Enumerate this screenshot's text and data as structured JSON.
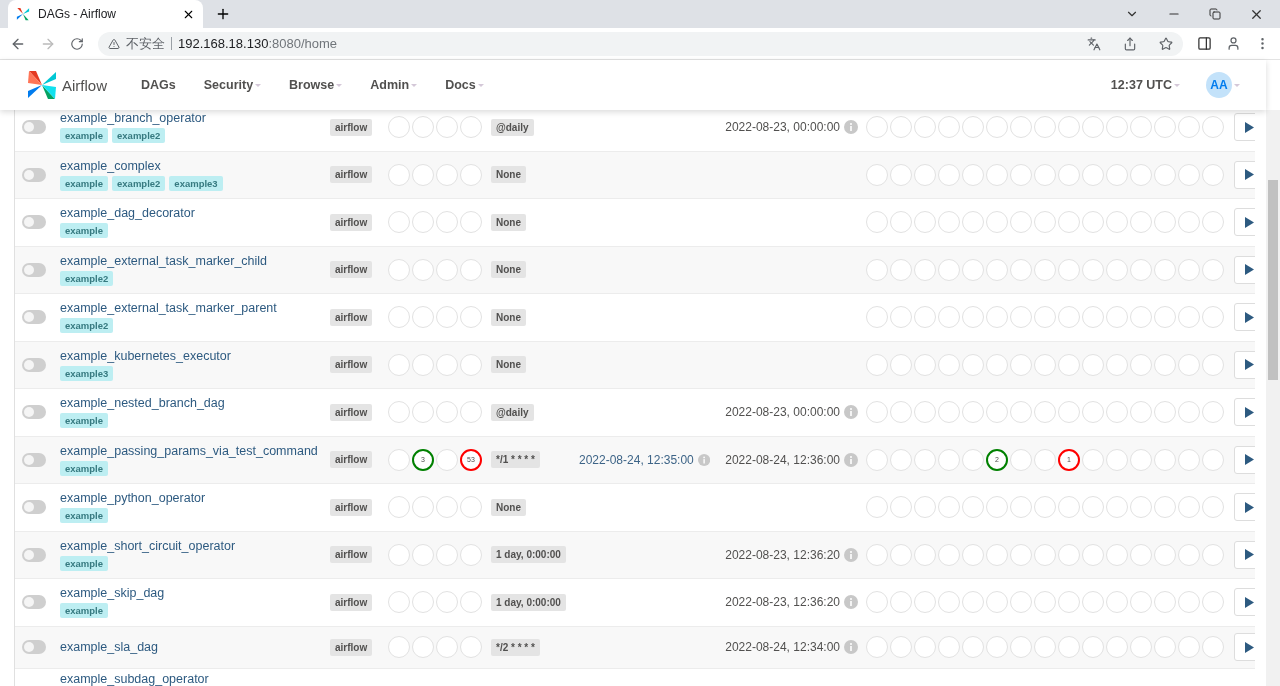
{
  "browser": {
    "tab_title": "DAGs - Airflow",
    "security_label": "不安全",
    "url_host": "192.168.18.130",
    "url_rest": ":8080/home"
  },
  "navbar": {
    "brand": "Airflow",
    "menu": [
      {
        "label": "DAGs",
        "dropdown": false
      },
      {
        "label": "Security",
        "dropdown": true
      },
      {
        "label": "Browse",
        "dropdown": true
      },
      {
        "label": "Admin",
        "dropdown": true
      },
      {
        "label": "Docs",
        "dropdown": true
      }
    ],
    "time": "12:37 UTC",
    "avatar": "AA"
  },
  "dags": [
    {
      "name": "example_branch_operator",
      "on": false,
      "tags": [
        "example",
        "example2"
      ],
      "owner": "airflow",
      "runs": [
        {
          "color": "#e2e2e2"
        },
        {
          "color": "#e2e2e2"
        },
        {
          "color": "#e2e2e2"
        },
        {
          "color": "#e2e2e2"
        }
      ],
      "schedule": "@daily",
      "next_run": "2022-08-23, 00:00:00",
      "tasks": [
        {
          "color": "#e2e2e2"
        },
        {
          "color": "#e2e2e2"
        },
        {
          "color": "#e2e2e2"
        },
        {
          "color": "#e2e2e2"
        },
        {
          "color": "#e2e2e2"
        },
        {
          "color": "#e2e2e2"
        },
        {
          "color": "#e2e2e2"
        },
        {
          "color": "#e2e2e2"
        },
        {
          "color": "#e2e2e2"
        },
        {
          "color": "#e2e2e2"
        },
        {
          "color": "#e2e2e2"
        },
        {
          "color": "#e2e2e2"
        },
        {
          "color": "#e2e2e2"
        },
        {
          "color": "#e2e2e2"
        },
        {
          "color": "#e2e2e2"
        }
      ]
    },
    {
      "name": "example_complex",
      "on": false,
      "tags": [
        "example",
        "example2",
        "example3"
      ],
      "owner": "airflow",
      "runs": [
        {
          "color": "#e2e2e2"
        },
        {
          "color": "#e2e2e2"
        },
        {
          "color": "#e2e2e2"
        },
        {
          "color": "#e2e2e2"
        }
      ],
      "schedule": "None",
      "tasks": [
        {
          "color": "#e2e2e2"
        },
        {
          "color": "#e2e2e2"
        },
        {
          "color": "#e2e2e2"
        },
        {
          "color": "#e2e2e2"
        },
        {
          "color": "#e2e2e2"
        },
        {
          "color": "#e2e2e2"
        },
        {
          "color": "#e2e2e2"
        },
        {
          "color": "#e2e2e2"
        },
        {
          "color": "#e2e2e2"
        },
        {
          "color": "#e2e2e2"
        },
        {
          "color": "#e2e2e2"
        },
        {
          "color": "#e2e2e2"
        },
        {
          "color": "#e2e2e2"
        },
        {
          "color": "#e2e2e2"
        },
        {
          "color": "#e2e2e2"
        }
      ]
    },
    {
      "name": "example_dag_decorator",
      "on": false,
      "tags": [
        "example"
      ],
      "owner": "airflow",
      "runs": [
        {
          "color": "#e2e2e2"
        },
        {
          "color": "#e2e2e2"
        },
        {
          "color": "#e2e2e2"
        },
        {
          "color": "#e2e2e2"
        }
      ],
      "schedule": "None",
      "tasks": [
        {
          "color": "#e2e2e2"
        },
        {
          "color": "#e2e2e2"
        },
        {
          "color": "#e2e2e2"
        },
        {
          "color": "#e2e2e2"
        },
        {
          "color": "#e2e2e2"
        },
        {
          "color": "#e2e2e2"
        },
        {
          "color": "#e2e2e2"
        },
        {
          "color": "#e2e2e2"
        },
        {
          "color": "#e2e2e2"
        },
        {
          "color": "#e2e2e2"
        },
        {
          "color": "#e2e2e2"
        },
        {
          "color": "#e2e2e2"
        },
        {
          "color": "#e2e2e2"
        },
        {
          "color": "#e2e2e2"
        },
        {
          "color": "#e2e2e2"
        }
      ]
    },
    {
      "name": "example_external_task_marker_child",
      "on": false,
      "tags": [
        "example2"
      ],
      "owner": "airflow",
      "runs": [
        {
          "color": "#e2e2e2"
        },
        {
          "color": "#e2e2e2"
        },
        {
          "color": "#e2e2e2"
        },
        {
          "color": "#e2e2e2"
        }
      ],
      "schedule": "None",
      "tasks": [
        {
          "color": "#e2e2e2"
        },
        {
          "color": "#e2e2e2"
        },
        {
          "color": "#e2e2e2"
        },
        {
          "color": "#e2e2e2"
        },
        {
          "color": "#e2e2e2"
        },
        {
          "color": "#e2e2e2"
        },
        {
          "color": "#e2e2e2"
        },
        {
          "color": "#e2e2e2"
        },
        {
          "color": "#e2e2e2"
        },
        {
          "color": "#e2e2e2"
        },
        {
          "color": "#e2e2e2"
        },
        {
          "color": "#e2e2e2"
        },
        {
          "color": "#e2e2e2"
        },
        {
          "color": "#e2e2e2"
        },
        {
          "color": "#e2e2e2"
        }
      ]
    },
    {
      "name": "example_external_task_marker_parent",
      "on": false,
      "tags": [
        "example2"
      ],
      "owner": "airflow",
      "runs": [
        {
          "color": "#e2e2e2"
        },
        {
          "color": "#e2e2e2"
        },
        {
          "color": "#e2e2e2"
        },
        {
          "color": "#e2e2e2"
        }
      ],
      "schedule": "None",
      "tasks": [
        {
          "color": "#e2e2e2"
        },
        {
          "color": "#e2e2e2"
        },
        {
          "color": "#e2e2e2"
        },
        {
          "color": "#e2e2e2"
        },
        {
          "color": "#e2e2e2"
        },
        {
          "color": "#e2e2e2"
        },
        {
          "color": "#e2e2e2"
        },
        {
          "color": "#e2e2e2"
        },
        {
          "color": "#e2e2e2"
        },
        {
          "color": "#e2e2e2"
        },
        {
          "color": "#e2e2e2"
        },
        {
          "color": "#e2e2e2"
        },
        {
          "color": "#e2e2e2"
        },
        {
          "color": "#e2e2e2"
        },
        {
          "color": "#e2e2e2"
        }
      ]
    },
    {
      "name": "example_kubernetes_executor",
      "on": false,
      "tags": [
        "example3"
      ],
      "owner": "airflow",
      "runs": [
        {
          "color": "#e2e2e2"
        },
        {
          "color": "#e2e2e2"
        },
        {
          "color": "#e2e2e2"
        },
        {
          "color": "#e2e2e2"
        }
      ],
      "schedule": "None",
      "tasks": [
        {
          "color": "#e2e2e2"
        },
        {
          "color": "#e2e2e2"
        },
        {
          "color": "#e2e2e2"
        },
        {
          "color": "#e2e2e2"
        },
        {
          "color": "#e2e2e2"
        },
        {
          "color": "#e2e2e2"
        },
        {
          "color": "#e2e2e2"
        },
        {
          "color": "#e2e2e2"
        },
        {
          "color": "#e2e2e2"
        },
        {
          "color": "#e2e2e2"
        },
        {
          "color": "#e2e2e2"
        },
        {
          "color": "#e2e2e2"
        },
        {
          "color": "#e2e2e2"
        },
        {
          "color": "#e2e2e2"
        },
        {
          "color": "#e2e2e2"
        }
      ]
    },
    {
      "name": "example_nested_branch_dag",
      "on": false,
      "tags": [
        "example"
      ],
      "owner": "airflow",
      "runs": [
        {
          "color": "#e2e2e2"
        },
        {
          "color": "#e2e2e2"
        },
        {
          "color": "#e2e2e2"
        },
        {
          "color": "#e2e2e2"
        }
      ],
      "schedule": "@daily",
      "next_run": "2022-08-23, 00:00:00",
      "tasks": [
        {
          "color": "#e2e2e2"
        },
        {
          "color": "#e2e2e2"
        },
        {
          "color": "#e2e2e2"
        },
        {
          "color": "#e2e2e2"
        },
        {
          "color": "#e2e2e2"
        },
        {
          "color": "#e2e2e2"
        },
        {
          "color": "#e2e2e2"
        },
        {
          "color": "#e2e2e2"
        },
        {
          "color": "#e2e2e2"
        },
        {
          "color": "#e2e2e2"
        },
        {
          "color": "#e2e2e2"
        },
        {
          "color": "#e2e2e2"
        },
        {
          "color": "#e2e2e2"
        },
        {
          "color": "#e2e2e2"
        },
        {
          "color": "#e2e2e2"
        }
      ]
    },
    {
      "name": "example_passing_params_via_test_command",
      "on": false,
      "tags": [
        "example"
      ],
      "owner": "airflow",
      "runs": [
        {
          "color": "#e2e2e2"
        },
        {
          "color": "#008000",
          "count": "3"
        },
        {
          "color": "#e2e2e2"
        },
        {
          "color": "#ff0000",
          "count": "53"
        }
      ],
      "schedule": "*/1 * * * *",
      "last_run": "2022-08-24, 12:35:00",
      "next_run": "2022-08-24, 12:36:00",
      "tasks": [
        {
          "color": "#e2e2e2"
        },
        {
          "color": "#e2e2e2"
        },
        {
          "color": "#e2e2e2"
        },
        {
          "color": "#e2e2e2"
        },
        {
          "color": "#e2e2e2"
        },
        {
          "color": "#008000",
          "count": "2"
        },
        {
          "color": "#e2e2e2"
        },
        {
          "color": "#e2e2e2"
        },
        {
          "color": "#ff0000",
          "count": "1"
        },
        {
          "color": "#e2e2e2"
        },
        {
          "color": "#e2e2e2"
        },
        {
          "color": "#e2e2e2"
        },
        {
          "color": "#e2e2e2"
        },
        {
          "color": "#e2e2e2"
        },
        {
          "color": "#e2e2e2"
        }
      ]
    },
    {
      "name": "example_python_operator",
      "on": false,
      "tags": [
        "example"
      ],
      "owner": "airflow",
      "runs": [
        {
          "color": "#e2e2e2"
        },
        {
          "color": "#e2e2e2"
        },
        {
          "color": "#e2e2e2"
        },
        {
          "color": "#e2e2e2"
        }
      ],
      "schedule": "None",
      "tasks": [
        {
          "color": "#e2e2e2"
        },
        {
          "color": "#e2e2e2"
        },
        {
          "color": "#e2e2e2"
        },
        {
          "color": "#e2e2e2"
        },
        {
          "color": "#e2e2e2"
        },
        {
          "color": "#e2e2e2"
        },
        {
          "color": "#e2e2e2"
        },
        {
          "color": "#e2e2e2"
        },
        {
          "color": "#e2e2e2"
        },
        {
          "color": "#e2e2e2"
        },
        {
          "color": "#e2e2e2"
        },
        {
          "color": "#e2e2e2"
        },
        {
          "color": "#e2e2e2"
        },
        {
          "color": "#e2e2e2"
        },
        {
          "color": "#e2e2e2"
        }
      ]
    },
    {
      "name": "example_short_circuit_operator",
      "on": false,
      "tags": [
        "example"
      ],
      "owner": "airflow",
      "runs": [
        {
          "color": "#e2e2e2"
        },
        {
          "color": "#e2e2e2"
        },
        {
          "color": "#e2e2e2"
        },
        {
          "color": "#e2e2e2"
        }
      ],
      "schedule": "1 day, 0:00:00",
      "next_run": "2022-08-23, 12:36:20",
      "tasks": [
        {
          "color": "#e2e2e2"
        },
        {
          "color": "#e2e2e2"
        },
        {
          "color": "#e2e2e2"
        },
        {
          "color": "#e2e2e2"
        },
        {
          "color": "#e2e2e2"
        },
        {
          "color": "#e2e2e2"
        },
        {
          "color": "#e2e2e2"
        },
        {
          "color": "#e2e2e2"
        },
        {
          "color": "#e2e2e2"
        },
        {
          "color": "#e2e2e2"
        },
        {
          "color": "#e2e2e2"
        },
        {
          "color": "#e2e2e2"
        },
        {
          "color": "#e2e2e2"
        },
        {
          "color": "#e2e2e2"
        },
        {
          "color": "#e2e2e2"
        }
      ]
    },
    {
      "name": "example_skip_dag",
      "on": false,
      "tags": [
        "example"
      ],
      "owner": "airflow",
      "runs": [
        {
          "color": "#e2e2e2"
        },
        {
          "color": "#e2e2e2"
        },
        {
          "color": "#e2e2e2"
        },
        {
          "color": "#e2e2e2"
        }
      ],
      "schedule": "1 day, 0:00:00",
      "next_run": "2022-08-23, 12:36:20",
      "tasks": [
        {
          "color": "#e2e2e2"
        },
        {
          "color": "#e2e2e2"
        },
        {
          "color": "#e2e2e2"
        },
        {
          "color": "#e2e2e2"
        },
        {
          "color": "#e2e2e2"
        },
        {
          "color": "#e2e2e2"
        },
        {
          "color": "#e2e2e2"
        },
        {
          "color": "#e2e2e2"
        },
        {
          "color": "#e2e2e2"
        },
        {
          "color": "#e2e2e2"
        },
        {
          "color": "#e2e2e2"
        },
        {
          "color": "#e2e2e2"
        },
        {
          "color": "#e2e2e2"
        },
        {
          "color": "#e2e2e2"
        },
        {
          "color": "#e2e2e2"
        }
      ]
    },
    {
      "name": "example_sla_dag",
      "on": false,
      "owner": "airflow",
      "runs": [
        {
          "color": "#e2e2e2"
        },
        {
          "color": "#e2e2e2"
        },
        {
          "color": "#e2e2e2"
        },
        {
          "color": "#e2e2e2"
        }
      ],
      "schedule": "*/2 * * * *",
      "next_run": "2022-08-24, 12:34:00",
      "tasks": [
        {
          "color": "#e2e2e2"
        },
        {
          "color": "#e2e2e2"
        },
        {
          "color": "#e2e2e2"
        },
        {
          "color": "#e2e2e2"
        },
        {
          "color": "#e2e2e2"
        },
        {
          "color": "#e2e2e2"
        },
        {
          "color": "#e2e2e2"
        },
        {
          "color": "#e2e2e2"
        },
        {
          "color": "#e2e2e2"
        },
        {
          "color": "#e2e2e2"
        },
        {
          "color": "#e2e2e2"
        },
        {
          "color": "#e2e2e2"
        },
        {
          "color": "#e2e2e2"
        },
        {
          "color": "#e2e2e2"
        },
        {
          "color": "#e2e2e2"
        }
      ]
    },
    {
      "name": "example_subdag_operator"
    }
  ]
}
